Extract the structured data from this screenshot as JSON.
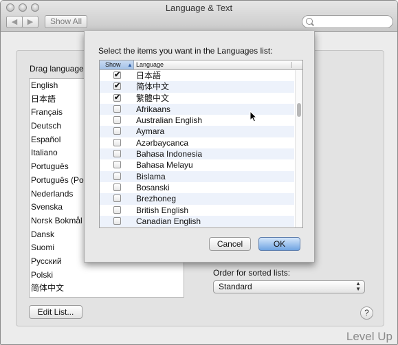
{
  "window": {
    "title": "Language & Text",
    "show_all_label": "Show All",
    "back_glyph": "◀",
    "forward_glyph": "▶",
    "search_placeholder": ""
  },
  "main": {
    "drag_title": "Drag language",
    "languages": [
      "English",
      "日本語",
      "Français",
      "Deutsch",
      "Español",
      "Italiano",
      "Português",
      "Português (Por",
      "Nederlands",
      "Svenska",
      "Norsk Bokmål",
      "Dansk",
      "Suomi",
      "Русский",
      "Polski",
      "简体中文"
    ],
    "edit_list_label": "Edit List...",
    "order_label": "Order for sorted lists:",
    "order_value": "Standard",
    "help_label": "?"
  },
  "sheet": {
    "prompt": "Select the items you want in the Languages list:",
    "col_show": "Show",
    "col_language": "Language",
    "rows": [
      {
        "name": "日本語",
        "checked": true
      },
      {
        "name": "简体中文",
        "checked": true
      },
      {
        "name": "繁體中文",
        "checked": true
      },
      {
        "name": "Afrikaans",
        "checked": false
      },
      {
        "name": "Australian English",
        "checked": false
      },
      {
        "name": "Aymara",
        "checked": false
      },
      {
        "name": "Azərbaycanca",
        "checked": false
      },
      {
        "name": "Bahasa Indonesia",
        "checked": false
      },
      {
        "name": "Bahasa Melayu",
        "checked": false
      },
      {
        "name": "Bislama",
        "checked": false
      },
      {
        "name": "Bosanski",
        "checked": false
      },
      {
        "name": "Brezhoneg",
        "checked": false
      },
      {
        "name": "British English",
        "checked": false
      },
      {
        "name": "Canadian English",
        "checked": false
      }
    ],
    "cancel_label": "Cancel",
    "ok_label": "OK"
  },
  "watermark": "Level Up",
  "icons": {
    "check_glyph": "✔",
    "sort_glyph": "▲",
    "select_arrows": "▲▼"
  }
}
